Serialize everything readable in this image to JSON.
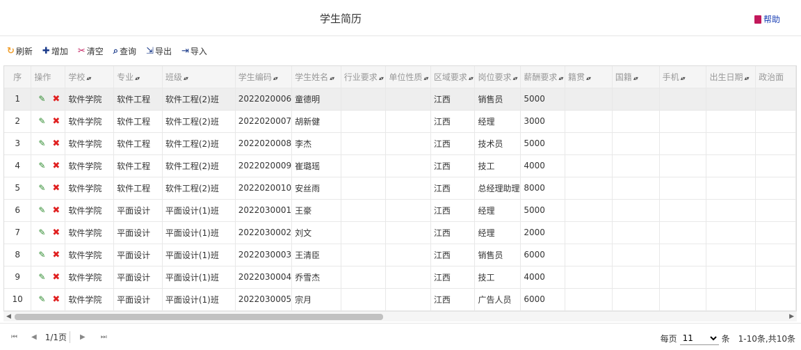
{
  "header": {
    "title": "学生简历",
    "help_label": "帮助"
  },
  "toolbar": {
    "refresh": "刷新",
    "add": "增加",
    "clear": "清空",
    "query": "查询",
    "export": "导出",
    "import": "导入"
  },
  "table": {
    "columns": [
      "序",
      "操作",
      "学校",
      "专业",
      "班级",
      "学生编码",
      "学生姓名",
      "行业要求",
      "单位性质",
      "区域要求",
      "岗位要求",
      "薪酬要求",
      "籍贯",
      "国籍",
      "手机",
      "出生日期",
      "政治面"
    ],
    "rows": [
      {
        "seq": "1",
        "school": "软件学院",
        "major": "软件工程",
        "class": "软件工程(2)班",
        "code": "2022020006",
        "name": "童德明",
        "region": "江西",
        "post": "销售员",
        "salary": "5000"
      },
      {
        "seq": "2",
        "school": "软件学院",
        "major": "软件工程",
        "class": "软件工程(2)班",
        "code": "2022020007",
        "name": "胡新健",
        "region": "江西",
        "post": "经理",
        "salary": "3000"
      },
      {
        "seq": "3",
        "school": "软件学院",
        "major": "软件工程",
        "class": "软件工程(2)班",
        "code": "2022020008",
        "name": "李杰",
        "region": "江西",
        "post": "技术员",
        "salary": "5000"
      },
      {
        "seq": "4",
        "school": "软件学院",
        "major": "软件工程",
        "class": "软件工程(2)班",
        "code": "2022020009",
        "name": "崔璐瑶",
        "region": "江西",
        "post": "技工",
        "salary": "4000"
      },
      {
        "seq": "5",
        "school": "软件学院",
        "major": "软件工程",
        "class": "软件工程(2)班",
        "code": "2022020010",
        "name": "安丝雨",
        "region": "江西",
        "post": "总经理助理",
        "salary": "8000"
      },
      {
        "seq": "6",
        "school": "软件学院",
        "major": "平面设计",
        "class": "平面设计(1)班",
        "code": "2022030001",
        "name": "王豪",
        "region": "江西",
        "post": "经理",
        "salary": "5000"
      },
      {
        "seq": "7",
        "school": "软件学院",
        "major": "平面设计",
        "class": "平面设计(1)班",
        "code": "2022030002",
        "name": "刘文",
        "region": "江西",
        "post": "经理",
        "salary": "2000"
      },
      {
        "seq": "8",
        "school": "软件学院",
        "major": "平面设计",
        "class": "平面设计(1)班",
        "code": "2022030003",
        "name": "王清臣",
        "region": "江西",
        "post": "销售员",
        "salary": "6000"
      },
      {
        "seq": "9",
        "school": "软件学院",
        "major": "平面设计",
        "class": "平面设计(1)班",
        "code": "2022030004",
        "name": "乔雪杰",
        "region": "江西",
        "post": "技工",
        "salary": "4000"
      },
      {
        "seq": "10",
        "school": "软件学院",
        "major": "平面设计",
        "class": "平面设计(1)班",
        "code": "2022030005",
        "name": "宗月",
        "region": "江西",
        "post": "广告人员",
        "salary": "6000"
      }
    ]
  },
  "pager": {
    "page_info": "1/1页",
    "per_page_label": "每页",
    "per_page_value": "11",
    "unit_label": "条",
    "summary": "1-10条,共10条"
  },
  "icons": {
    "refresh": "refresh-icon",
    "add": "plus-icon",
    "clear": "scissors-icon",
    "query": "search-icon",
    "export": "export-icon",
    "import": "import-icon",
    "edit": "pencil-icon",
    "delete": "delete-icon",
    "help": "book-icon"
  },
  "colors": {
    "help_link": "#1a3fb4",
    "edit_icon": "#2e8b2e",
    "delete_icon": "#e02020",
    "refresh_icon": "#f0a030",
    "clear_icon": "#c2185b"
  }
}
